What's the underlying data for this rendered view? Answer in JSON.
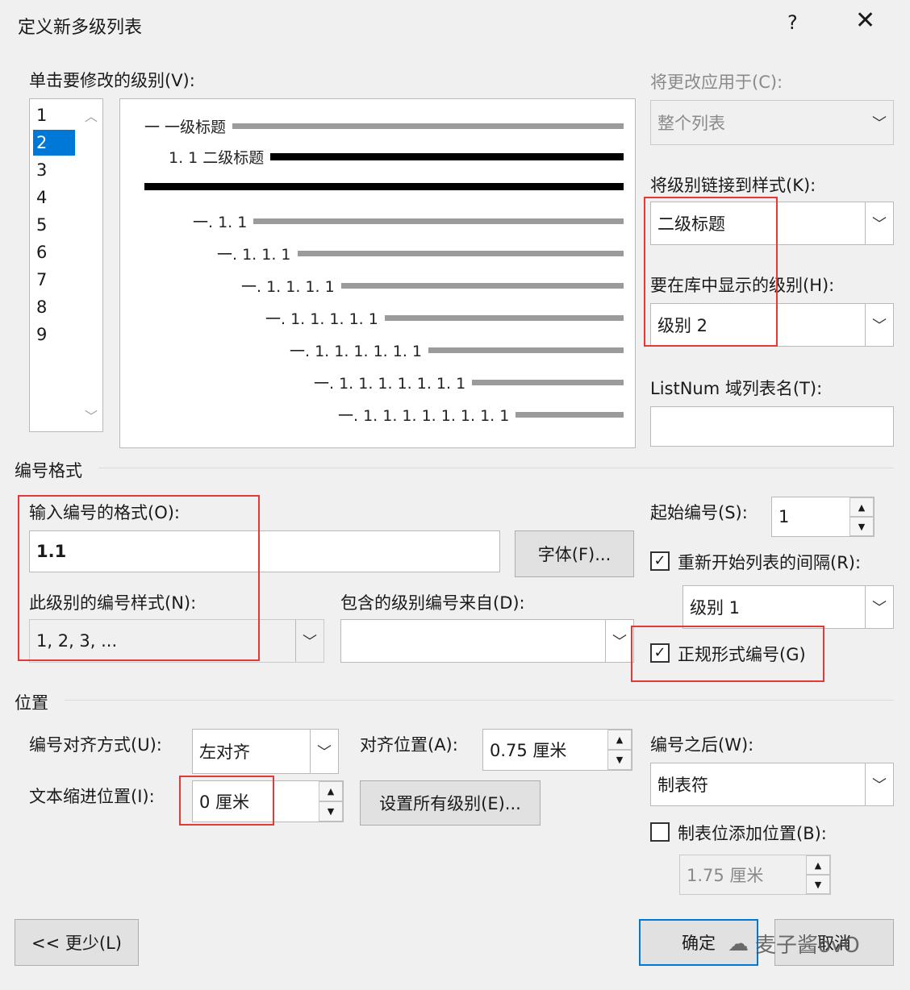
{
  "dialog": {
    "title": "定义新多级列表",
    "help": "?",
    "close": "✕"
  },
  "level_list": {
    "label": "单击要修改的级别(V):",
    "items": [
      "1",
      "2",
      "3",
      "4",
      "5",
      "6",
      "7",
      "8",
      "9"
    ],
    "selected": "2"
  },
  "preview": {
    "rows": [
      {
        "text": "一 一级标题",
        "bold": false
      },
      {
        "text": "1. 1 二级标题",
        "bold": true
      },
      {
        "text": "",
        "bold": true
      },
      {
        "text": "一. 1. 1",
        "bold": false
      },
      {
        "text": "一. 1. 1. 1",
        "bold": false
      },
      {
        "text": "一. 1. 1. 1. 1",
        "bold": false
      },
      {
        "text": "一. 1. 1. 1. 1. 1",
        "bold": false
      },
      {
        "text": "一. 1. 1. 1. 1. 1. 1",
        "bold": false
      },
      {
        "text": "一. 1. 1. 1. 1. 1. 1. 1",
        "bold": false
      },
      {
        "text": "一. 1. 1. 1. 1. 1. 1. 1. 1",
        "bold": false
      }
    ]
  },
  "apply_to": {
    "label": "将更改应用于(C):",
    "value": "整个列表"
  },
  "link_style": {
    "label": "将级别链接到样式(K):",
    "value": "二级标题"
  },
  "gallery_level": {
    "label": "要在库中显示的级别(H):",
    "value": "级别 2"
  },
  "listnum": {
    "label": "ListNum 域列表名(T):",
    "value": ""
  },
  "number_format": {
    "section": "编号格式",
    "format_label": "输入编号的格式(O):",
    "format_value": "1.1",
    "font_button": "字体(F)...",
    "style_label": "此级别的编号样式(N):",
    "style_value": "1, 2, 3, ...",
    "include_label": "包含的级别编号来自(D):",
    "include_value": "",
    "start_label": "起始编号(S):",
    "start_value": "1",
    "restart_label": "重新开始列表的间隔(R):",
    "restart_checked": true,
    "restart_value": "级别 1",
    "legal_label": "正规形式编号(G)",
    "legal_checked": true
  },
  "position": {
    "section": "位置",
    "align_label": "编号对齐方式(U):",
    "align_value": "左对齐",
    "at_label": "对齐位置(A):",
    "at_value": "0.75 厘米",
    "indent_label": "文本缩进位置(I):",
    "indent_value": "0 厘米",
    "set_all_button": "设置所有级别(E)...",
    "follow_label": "编号之后(W):",
    "follow_value": "制表符",
    "tab_label": "制表位添加位置(B):",
    "tab_checked": false,
    "tab_value": "1.75 厘米"
  },
  "footer": {
    "less_button": "<< 更少(L)",
    "ok_button": "确定",
    "cancel_button": "取消",
    "watermark": "麦子酱ovO"
  },
  "colors": {
    "selection": "#0078d7",
    "highlight_box": "#e53935"
  }
}
